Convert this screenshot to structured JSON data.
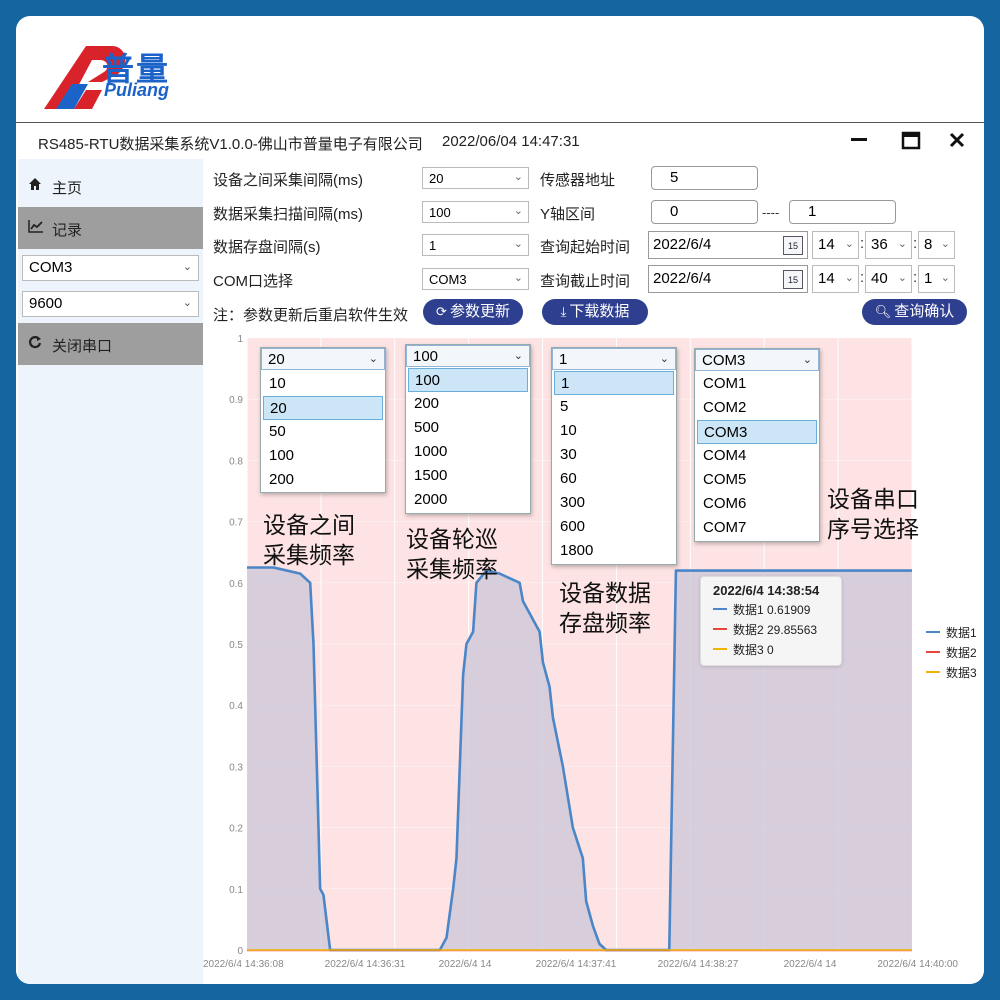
{
  "brand": {
    "cn": "普量",
    "en": "Puliang",
    "colors": {
      "red": "#d9232a",
      "blue": "#1b63c8"
    }
  },
  "window": {
    "title": "RS485-RTU数据采集系统V1.0.0-佛山市普量电子有限公司",
    "datetime": "2022/06/04 14:47:31",
    "minimize": "−",
    "maximize": "☐",
    "close": "✕"
  },
  "sidebar": {
    "home": {
      "icon": "home-icon",
      "label": "主页"
    },
    "record": {
      "icon": "chart-icon",
      "label": "记录"
    },
    "com_select": "COM3",
    "baud_select": "9600",
    "close_port": {
      "icon": "refresh-icon",
      "label": "关闭串口"
    }
  },
  "form": {
    "device_interval_label": "设备之间采集间隔(ms)",
    "device_interval_value": "20",
    "scan_interval_label": "数据采集扫描间隔(ms)",
    "scan_interval_value": "100",
    "storage_interval_label": "数据存盘间隔(s)",
    "storage_interval_value": "1",
    "com_label": "COM口选择",
    "com_value": "COM3",
    "sensor_addr_label": "传感器地址",
    "sensor_addr_value": "5",
    "y_range_label": "Y轴区间",
    "y_min": "0",
    "y_sep": "----",
    "y_max": "1",
    "start_label": "查询起始时间",
    "start_date": "2022/6/4",
    "start_h": "14",
    "start_m": "36",
    "start_s": "8",
    "end_label": "查询截止时间",
    "end_date": "2022/6/4",
    "end_h": "14",
    "end_m": "40",
    "end_s": "1",
    "calendar_day": "15",
    "note": "注：参数更新后重启软件生效",
    "update_btn": "参数更新",
    "download_btn": "下载数据",
    "query_btn": "查询确认"
  },
  "dropdowns": {
    "device_interval": {
      "selected": "20",
      "options": [
        "10",
        "20",
        "50",
        "100",
        "200"
      ]
    },
    "scan_interval": {
      "selected": "100",
      "options": [
        "100",
        "200",
        "500",
        "1000",
        "1500",
        "2000"
      ]
    },
    "storage_interval": {
      "selected": "1",
      "options": [
        "1",
        "5",
        "10",
        "30",
        "60",
        "300",
        "600",
        "1800"
      ]
    },
    "com_port": {
      "selected": "COM3",
      "options": [
        "COM1",
        "COM2",
        "COM3",
        "COM4",
        "COM5",
        "COM6",
        "COM7"
      ]
    }
  },
  "annotations": {
    "a1": [
      "设备之间",
      "采集频率"
    ],
    "a2": [
      "设备轮巡",
      "采集频率"
    ],
    "a3": [
      "设备数据",
      "存盘频率"
    ],
    "a4": [
      "设备串口",
      "序号选择"
    ]
  },
  "tooltip": {
    "title": "2022/6/4 14:38:54",
    "rows": [
      {
        "label": "数据1 0.61909",
        "color": "#4a86c8"
      },
      {
        "label": "数据2 29.85563",
        "color": "#e8453c"
      },
      {
        "label": "数据3 0",
        "color": "#f0b400"
      }
    ]
  },
  "chart_data": {
    "type": "area",
    "ylim": [
      0,
      1
    ],
    "yticks": [
      "0",
      "0.1",
      "0.2",
      "0.3",
      "0.4",
      "0.5",
      "0.6",
      "0.7",
      "0.8",
      "0.9",
      "1"
    ],
    "xticks": [
      "2022/6/4 14:36:08",
      "2022/6/4 14:36:31",
      "2022/6/4 14",
      "2022/6/4 14:37:41",
      "2022/6/4 14:38:27",
      "2022/6/4 14",
      "2022/6/4 14:40:00"
    ],
    "legend": [
      "数据1",
      "数据2",
      "数据3"
    ],
    "legend_position": "right",
    "colors": {
      "series1": "#4a86c8",
      "series2": "#e8453c",
      "series3": "#f0b400",
      "plot_bg": "#fde3e3",
      "area_fill": "#c9c6d8"
    },
    "series": [
      {
        "name": "数据1",
        "values": [
          [
            0.0,
            0.625
          ],
          [
            0.04,
            0.625
          ],
          [
            0.06,
            0.62
          ],
          [
            0.08,
            0.615
          ],
          [
            0.095,
            0.6
          ],
          [
            0.1,
            0.5
          ],
          [
            0.105,
            0.3
          ],
          [
            0.11,
            0.1
          ],
          [
            0.115,
            0.09
          ],
          [
            0.125,
            0.0
          ],
          [
            0.29,
            0.0
          ],
          [
            0.3,
            0.02
          ],
          [
            0.31,
            0.1
          ],
          [
            0.315,
            0.15
          ],
          [
            0.325,
            0.45
          ],
          [
            0.33,
            0.5
          ],
          [
            0.34,
            0.52
          ],
          [
            0.345,
            0.6
          ],
          [
            0.36,
            0.62
          ],
          [
            0.38,
            0.615
          ],
          [
            0.41,
            0.6
          ],
          [
            0.415,
            0.57
          ],
          [
            0.44,
            0.52
          ],
          [
            0.445,
            0.47
          ],
          [
            0.455,
            0.43
          ],
          [
            0.46,
            0.38
          ],
          [
            0.475,
            0.3
          ],
          [
            0.49,
            0.2
          ],
          [
            0.505,
            0.15
          ],
          [
            0.51,
            0.08
          ],
          [
            0.52,
            0.04
          ],
          [
            0.53,
            0.01
          ],
          [
            0.54,
            0.0
          ],
          [
            0.635,
            0.0
          ],
          [
            0.645,
            0.62
          ],
          [
            1.0,
            0.62
          ]
        ]
      },
      {
        "name": "数据2",
        "values": [
          [
            0.0,
            0.0
          ],
          [
            1.0,
            0.0
          ]
        ]
      },
      {
        "name": "数据3",
        "values": [
          [
            0.0,
            0.0
          ],
          [
            1.0,
            0.0
          ]
        ]
      }
    ]
  }
}
